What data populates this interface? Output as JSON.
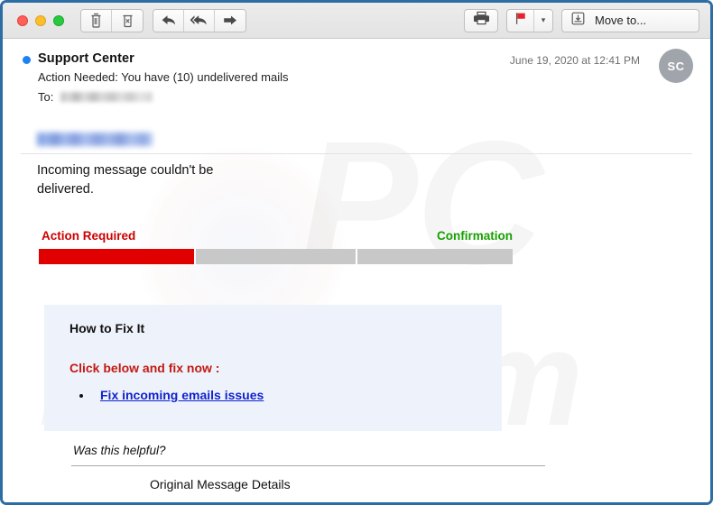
{
  "window": {
    "traffic_lights": [
      "close",
      "minimize",
      "zoom"
    ]
  },
  "toolbar": {
    "delete_icon": "trash-icon",
    "junk_icon": "trash-x-icon",
    "reply_icon": "reply-arrow-icon",
    "reply_all_icon": "reply-all-arrow-icon",
    "forward_icon": "forward-arrow-icon",
    "print_icon": "printer-icon",
    "flag_icon": "red-flag-icon",
    "flag_dropdown_icon": "chevron-down-icon",
    "move_to_icon": "archive-box-icon",
    "move_to_label": "Move to...",
    "flag_color": "#e8232a"
  },
  "message": {
    "sender": "Support Center",
    "subject": "Action Needed: You have (10) undelivered mails",
    "to_label": "To:",
    "to_value_redacted": "",
    "date": "June 19, 2020 at 12:41 PM",
    "avatar_initials": "SC",
    "unread": true
  },
  "body": {
    "domain_redacted": "",
    "notice": "Incoming message  couldn't be delivered.",
    "status": {
      "left_label": "Action Required",
      "right_label": "Confirmation",
      "left_color": "#cc0000",
      "right_color": "#16a000",
      "segments": [
        {
          "state": "active",
          "color": "#e00000"
        },
        {
          "state": "inactive",
          "color": "#c8c8c8"
        },
        {
          "state": "inactive",
          "color": "#c8c8c8"
        }
      ]
    },
    "fix_panel": {
      "title": "How to Fix It",
      "cta": "Click below and fix now :",
      "link_text": "Fix incoming emails issues",
      "link_color": "#1122cc",
      "background": "#eef3fb"
    },
    "helpful_text": "Was this helpful?",
    "original_message_details": "Original Message Details"
  },
  "watermarks": {
    "top": "PC",
    "bottom": "risk.com"
  }
}
